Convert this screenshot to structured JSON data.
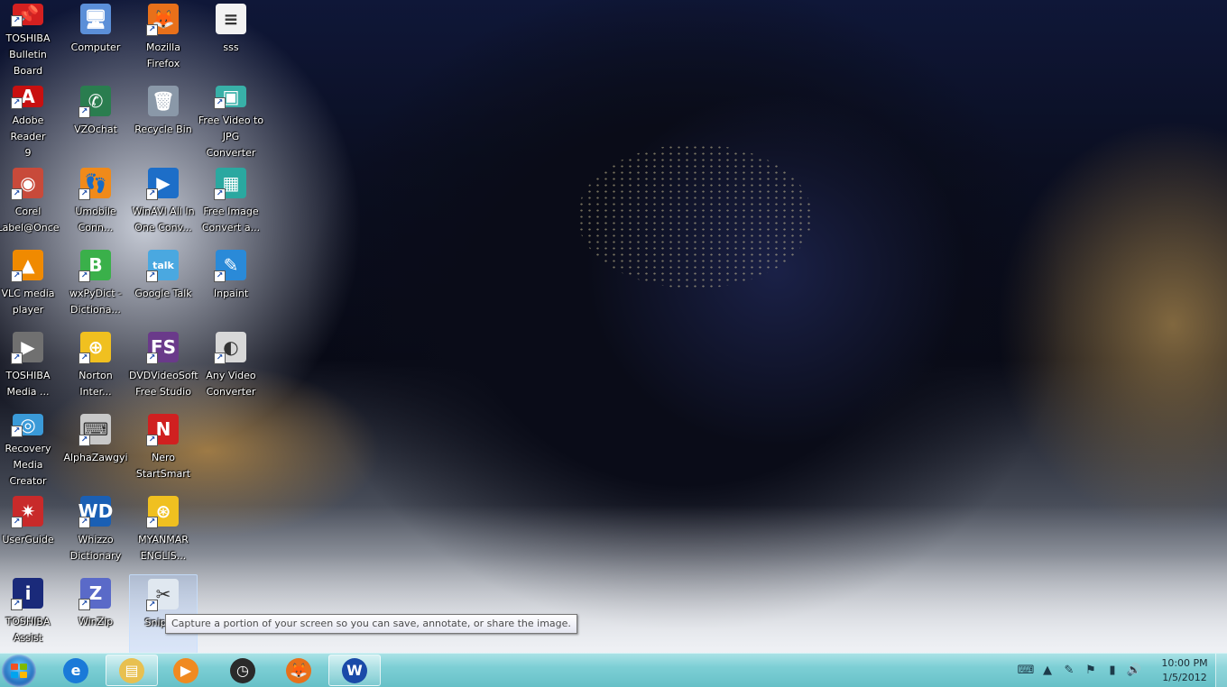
{
  "desktop": {
    "icons": [
      {
        "label": "TOSHIBA\nBulletin Board",
        "icon": "pushpin-icon",
        "color": "#d42020",
        "glyph": "📌"
      },
      {
        "label": "Computer",
        "icon": "computer-icon",
        "color": "#5b8fd8",
        "glyph": "🖥"
      },
      {
        "label": "Mozilla Firefox",
        "icon": "firefox-icon",
        "color": "#e8701a",
        "glyph": "🦊"
      },
      {
        "label": "sss",
        "icon": "text-file-icon",
        "color": "#f2f2f2",
        "glyph": "≡"
      },
      {
        "label": "Adobe Reader\n9",
        "icon": "pdf-icon",
        "color": "#c81010",
        "glyph": "A"
      },
      {
        "label": "VZOchat",
        "icon": "chat-icon",
        "color": "#2a7d4f",
        "glyph": "✆"
      },
      {
        "label": "Recycle Bin",
        "icon": "recycle-bin-icon",
        "color": "#8a98a8",
        "glyph": "🗑"
      },
      {
        "label": "Free Video to\nJPG Converter",
        "icon": "video-jpg-icon",
        "color": "#38b0a8",
        "glyph": "▣"
      },
      {
        "label": "Corel\nLabel@Once",
        "icon": "disc-label-icon",
        "color": "#c84a3a",
        "glyph": "◉"
      },
      {
        "label": "Umobile\nConn...",
        "icon": "footprint-icon",
        "color": "#f08a1a",
        "glyph": "👣"
      },
      {
        "label": "WinAVI All In\nOne Conv...",
        "icon": "winavi-icon",
        "color": "#1d6ec8",
        "glyph": "▶"
      },
      {
        "label": "Free Image\nConvert a...",
        "icon": "image-convert-icon",
        "color": "#2aa8a0",
        "glyph": "▦"
      },
      {
        "label": "VLC media\nplayer",
        "icon": "vlc-cone-icon",
        "color": "#f08a00",
        "glyph": "▲"
      },
      {
        "label": "wxPyDict -\nDictiona...",
        "icon": "dictionary-icon",
        "color": "#3ab04a",
        "glyph": "B"
      },
      {
        "label": "Google Talk",
        "icon": "google-talk-icon",
        "color": "#4aa8e0",
        "glyph": "talk"
      },
      {
        "label": "Inpaint",
        "icon": "inpaint-icon",
        "color": "#2a8ad8",
        "glyph": "✎"
      },
      {
        "label": "TOSHIBA\nMedia ...",
        "icon": "media-play-icon",
        "color": "#707070",
        "glyph": "▶"
      },
      {
        "label": "Norton\nInter...",
        "icon": "norton-globe-icon",
        "color": "#f0c020",
        "glyph": "⊕"
      },
      {
        "label": "DVDVideoSoft\nFree Studio",
        "icon": "free-studio-icon",
        "color": "#6a3a8a",
        "glyph": "FS"
      },
      {
        "label": "Any Video\nConverter",
        "icon": "video-converter-icon",
        "color": "#d8d8d8",
        "glyph": "◐"
      },
      {
        "label": "Recovery\nMedia Creator",
        "icon": "recovery-disc-icon",
        "color": "#3a9ad8",
        "glyph": "◎"
      },
      {
        "label": "AlphaZawgyi",
        "icon": "keyboard-icon",
        "color": "#c8c8c8",
        "glyph": "⌨"
      },
      {
        "label": "Nero\nStartSmart",
        "icon": "nero-icon",
        "color": "#d02020",
        "glyph": "N"
      },
      {
        "label": "UserGuide",
        "icon": "compass-star-icon",
        "color": "#c82a2a",
        "glyph": "✷"
      },
      {
        "label": "Whizzo\nDictionary",
        "icon": "whizzo-icon",
        "color": "#1a5fb4",
        "glyph": "WD"
      },
      {
        "label": "MYANMAR\nENGLIS...",
        "icon": "myanmar-dict-icon",
        "color": "#f0c020",
        "glyph": "⊛"
      },
      {
        "label": "TOSHIBA\nAssist",
        "icon": "info-assist-icon",
        "color": "#1a2a7a",
        "glyph": "i"
      },
      {
        "label": "WinZip",
        "icon": "winzip-icon",
        "color": "#5a6ac8",
        "glyph": "Z"
      },
      {
        "label": "Snippin",
        "icon": "scissors-icon",
        "color": "#e0e8f0",
        "glyph": "✂"
      }
    ]
  },
  "tooltip": {
    "text": "Capture a portion of your screen so you can save, annotate, or share the image."
  },
  "taskbar": {
    "start_label": "Start",
    "buttons": [
      {
        "name": "internet-explorer",
        "icon": "internet-explorer-icon",
        "color": "#1a7ad8",
        "glyph": "e"
      },
      {
        "name": "windows-explorer",
        "icon": "folder-icon",
        "color": "#e8c050",
        "glyph": "▤"
      },
      {
        "name": "media-player",
        "icon": "media-player-icon",
        "color": "#f08a20",
        "glyph": "▶"
      },
      {
        "name": "clock-app",
        "icon": "clock-icon",
        "color": "#2a2a2a",
        "glyph": "◷"
      },
      {
        "name": "firefox",
        "icon": "firefox-icon",
        "color": "#e8701a",
        "glyph": "🦊"
      },
      {
        "name": "word",
        "icon": "word-icon",
        "color": "#1a4aa8",
        "glyph": "W"
      }
    ],
    "tray": [
      {
        "name": "keyboard",
        "icon": "keyboard-icon",
        "glyph": "⌨"
      },
      {
        "name": "show-hidden",
        "icon": "chevron-up-icon",
        "glyph": "▲"
      },
      {
        "name": "pin",
        "icon": "pin-icon",
        "glyph": "✎"
      },
      {
        "name": "action-center",
        "icon": "action-center-flag-icon",
        "glyph": "⚑"
      },
      {
        "name": "network",
        "icon": "network-icon",
        "glyph": "▮"
      },
      {
        "name": "volume",
        "icon": "speaker-icon",
        "glyph": "🔊"
      }
    ],
    "clock": {
      "time": "10:00 PM",
      "date": "1/5/2012"
    }
  }
}
